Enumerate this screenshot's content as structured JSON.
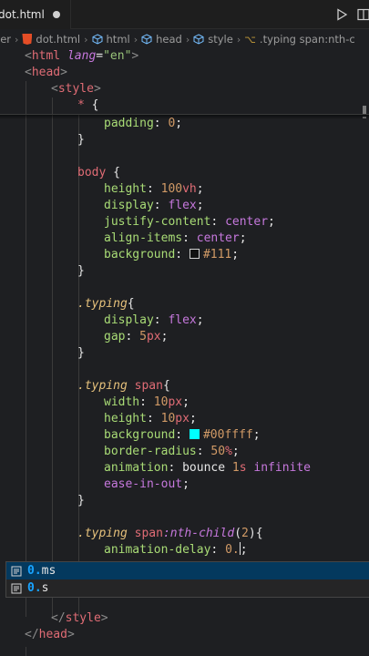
{
  "tab": {
    "label": "dot.html"
  },
  "breadcrumb": {
    "items": [
      "ler",
      "dot.html",
      "html",
      "head",
      "style",
      ".typing span:nth-c"
    ]
  },
  "code": {
    "html_tag": "html",
    "lang_attr": "lang",
    "lang_value": "\"en\"",
    "head_tag": "head",
    "style_tag": "style",
    "star": "*",
    "padding_prop": "padding",
    "padding_val": "0",
    "body_sel": "body",
    "height_prop": "height",
    "height_num": "100",
    "height_unit": "vh",
    "display_prop": "display",
    "display_val": "flex",
    "justify_prop": "justify-content",
    "justify_val": "center",
    "align_prop": "align-items",
    "align_val": "center",
    "background_prop": "background",
    "bg1_val": "#111",
    "typing_sel": ".typing",
    "display2_val": "flex",
    "gap_prop": "gap",
    "gap_num": "5",
    "gap_unit": "px",
    "typing_span_cls": ".typing",
    "span_tag": "span",
    "width_prop": "width",
    "width_num": "10",
    "width_unit": "px",
    "height2_num": "10",
    "height2_unit": "px",
    "bg2_val": "#00ffff",
    "radius_prop": "border-radius",
    "radius_num": "50",
    "radius_unit": "%",
    "animation_prop": "animation",
    "anim_name": "bounce",
    "anim_num": "1",
    "anim_unit": "s",
    "anim_infinite": "infinite",
    "anim_ease": "ease-in-out",
    "nth_pseudo": ":nth-child",
    "nth_arg": "2",
    "delay_prop": "animation-delay",
    "delay_val": "0.",
    "close_style": "style",
    "close_head": "head"
  },
  "suggest": {
    "items": [
      {
        "match": "0.",
        "rest": "ms"
      },
      {
        "match": "0.",
        "rest": "s"
      }
    ]
  },
  "colors": {
    "swatch1": "#111111",
    "swatch2": "#00ffff"
  }
}
